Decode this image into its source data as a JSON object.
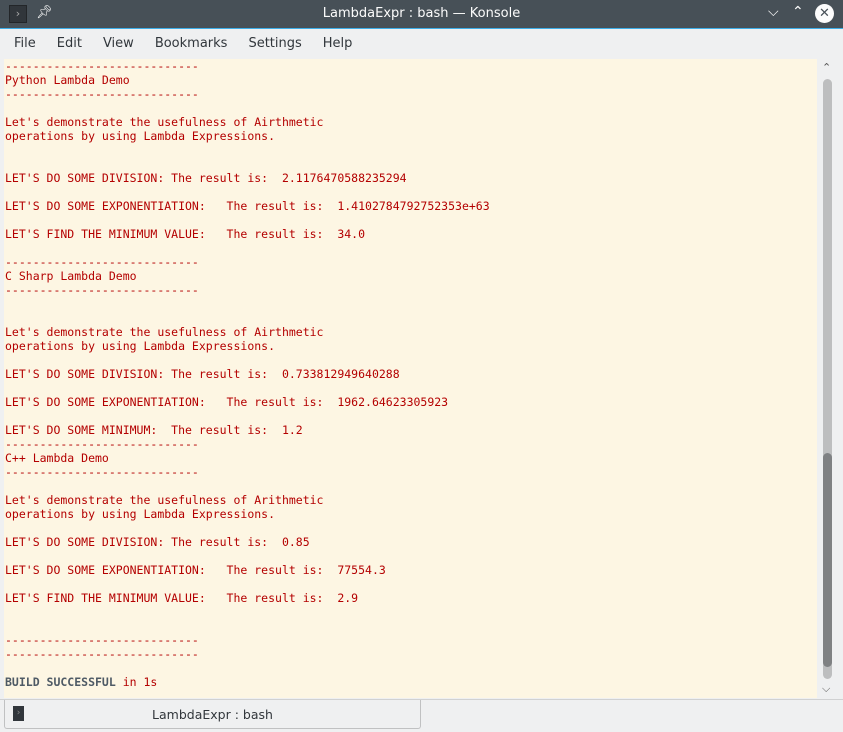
{
  "window": {
    "title": "LambdaExpr : bash — Konsole",
    "icons": [
      "terminal-icon",
      "pin-icon",
      "minimize-icon",
      "maximize-icon",
      "close-icon"
    ]
  },
  "menu": [
    "File",
    "Edit",
    "View",
    "Bookmarks",
    "Settings",
    "Help"
  ],
  "terminal": {
    "lines": [
      "----------------------------",
      "Python Lambda Demo",
      "----------------------------",
      "",
      "Let's demonstrate the usefulness of Airthmetic",
      "operations by using Lambda Expressions.",
      "",
      "",
      "LET'S DO SOME DIVISION: The result is:  2.1176470588235294",
      "",
      "LET'S DO SOME EXPONENTIATION:   The result is:  1.4102784792752353e+63",
      "",
      "LET'S FIND THE MINIMUM VALUE:   The result is:  34.0",
      "",
      "----------------------------",
      "C Sharp Lambda Demo",
      "----------------------------",
      "",
      "",
      "Let's demonstrate the usefulness of Airthmetic",
      "operations by using Lambda Expressions.",
      "",
      "LET'S DO SOME DIVISION: The result is:  0.733812949640288",
      "",
      "LET'S DO SOME EXPONENTIATION:   The result is:  1962.64623305923",
      "",
      "LET'S DO SOME MINIMUM:  The result is:  1.2",
      "----------------------------",
      "C++ Lambda Demo",
      "----------------------------",
      "",
      "Let's demonstrate the usefulness of Arithmetic",
      "operations by using Lambda Expressions.",
      "",
      "LET'S DO SOME DIVISION: The result is:  0.85",
      "",
      "LET'S DO SOME EXPONENTIATION:   The result is:  77554.3",
      "",
      "LET'S FIND THE MINIMUM VALUE:   The result is:  2.9",
      "",
      "",
      "----------------------------",
      "----------------------------",
      ""
    ],
    "build_status": "BUILD SUCCESSFUL",
    "build_time": " in 1s",
    "scroll_position_percent": 100
  },
  "tabs": [
    {
      "label": "LambdaExpr : bash"
    }
  ]
}
